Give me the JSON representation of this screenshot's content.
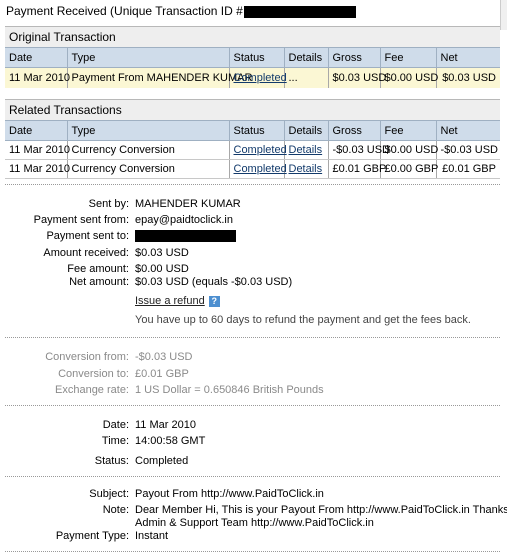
{
  "page": {
    "title": "Payment Received (Unique Transaction ID #"
  },
  "original": {
    "heading": "Original Transaction",
    "columns": [
      "Date",
      "Type",
      "Status",
      "Details",
      "Gross",
      "Fee",
      "Net"
    ],
    "rows": [
      {
        "date": "11 Mar 2010",
        "type": "Payment From MAHENDER KUMAR",
        "status": "Completed",
        "details": "...",
        "gross": "$0.03 USD",
        "fee": "$0.00 USD",
        "net": "$0.03 USD"
      }
    ]
  },
  "related": {
    "heading": "Related Transactions",
    "columns": [
      "Date",
      "Type",
      "Status",
      "Details",
      "Gross",
      "Fee",
      "Net"
    ],
    "rows": [
      {
        "date": "11 Mar 2010",
        "type": "Currency Conversion",
        "status": "Completed",
        "details": "Details",
        "gross": "-$0.03 USD",
        "fee": "$0.00 USD",
        "net": "-$0.03 USD"
      },
      {
        "date": "11 Mar 2010",
        "type": "Currency Conversion",
        "status": "Completed",
        "details": "Details",
        "gross": "£0.01 GBP",
        "fee": "£0.00 GBP",
        "net": "£0.01 GBP"
      }
    ]
  },
  "payment": {
    "sent_by_label": "Sent by:",
    "sent_by": "MAHENDER KUMAR",
    "sent_from_label": "Payment sent from:",
    "sent_from": "epay@paidtoclick.in",
    "sent_to_label": "Payment sent to:",
    "amount_label": "Amount received:",
    "amount": "$0.03 USD",
    "fee_label": "Fee amount:",
    "fee": "$0.00 USD",
    "net_label": "Net amount:",
    "net": "$0.03 USD (equals -$0.03 USD)",
    "refund_link": "Issue a refund",
    "help_icon": "?",
    "refund_note": "You have up to 60 days to refund the payment and get the fees back."
  },
  "conversion": {
    "from_label": "Conversion from:",
    "from": "-$0.03 USD",
    "to_label": "Conversion to:",
    "to": "£0.01 GBP",
    "rate_label": "Exchange rate:",
    "rate": "1 US Dollar = 0.650846 British Pounds"
  },
  "timing": {
    "date_label": "Date:",
    "date": "11 Mar 2010",
    "time_label": "Time:",
    "time": "14:00:58 GMT",
    "status_label": "Status:",
    "status": "Completed"
  },
  "message": {
    "subject_label": "Subject:",
    "subject": "Payout From http://www.PaidToClick.in",
    "note_label": "Note:",
    "note_line1": "Dear Member Hi, This is your Payout From http://www.PaidToClick.in Thanks,",
    "note_line2": "Admin & Support Team http://www.PaidToClick.in",
    "type_label": "Payment Type:",
    "type": "Instant"
  }
}
